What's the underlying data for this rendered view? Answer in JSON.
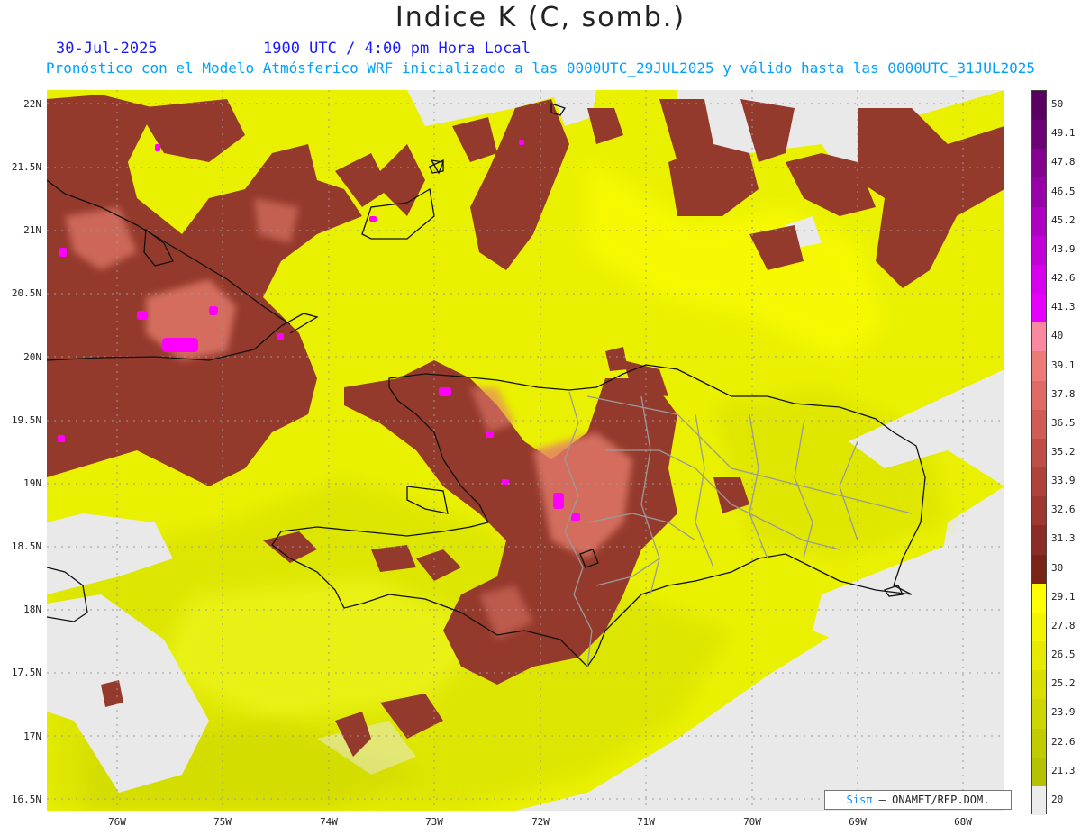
{
  "title": "Indice K (C, somb.)",
  "date": "30-Jul-2025",
  "valid_time": "1900 UTC / 4:00 pm Hora Local",
  "subtitle": "Pronóstico con el Modelo Atmósferico WRF inicializado a las 0000UTC_29JUL2025 y válido hasta las  0000UTC_31JUL2025",
  "lat_labels": [
    "22N",
    "21.5N",
    "21N",
    "20.5N",
    "20N",
    "19.5N",
    "19N",
    "18.5N",
    "18N",
    "17.5N",
    "17N",
    "16.5N"
  ],
  "lon_labels": [
    "76W",
    "75W",
    "74W",
    "73W",
    "72W",
    "71W",
    "70W",
    "69W",
    "68W"
  ],
  "colorbar": {
    "labels": [
      "50",
      "49.1",
      "47.8",
      "46.5",
      "45.2",
      "43.9",
      "42.6",
      "41.3",
      "40",
      "39.1",
      "37.8",
      "36.5",
      "35.2",
      "33.9",
      "32.6",
      "31.3",
      "30",
      "29.1",
      "27.8",
      "26.5",
      "25.2",
      "23.9",
      "22.6",
      "21.3",
      "20"
    ],
    "colors": [
      "#5a0060",
      "#6e0078",
      "#830090",
      "#9800a8",
      "#ad00c0",
      "#c200d8",
      "#d600ee",
      "#e800ff",
      "#f988a0",
      "#ec7a76",
      "#de6a66",
      "#d05c56",
      "#c04e48",
      "#b0423c",
      "#a03832",
      "#8c2c26",
      "#7a2418",
      "#ffff00",
      "#f2f400",
      "#e6ea00",
      "#d9e000",
      "#ccd600",
      "#c0cc00",
      "#b4c200",
      "#ececec"
    ]
  },
  "credit": {
    "brand": "Sisπ",
    "org": " – ONAMET/REP.DOM."
  }
}
